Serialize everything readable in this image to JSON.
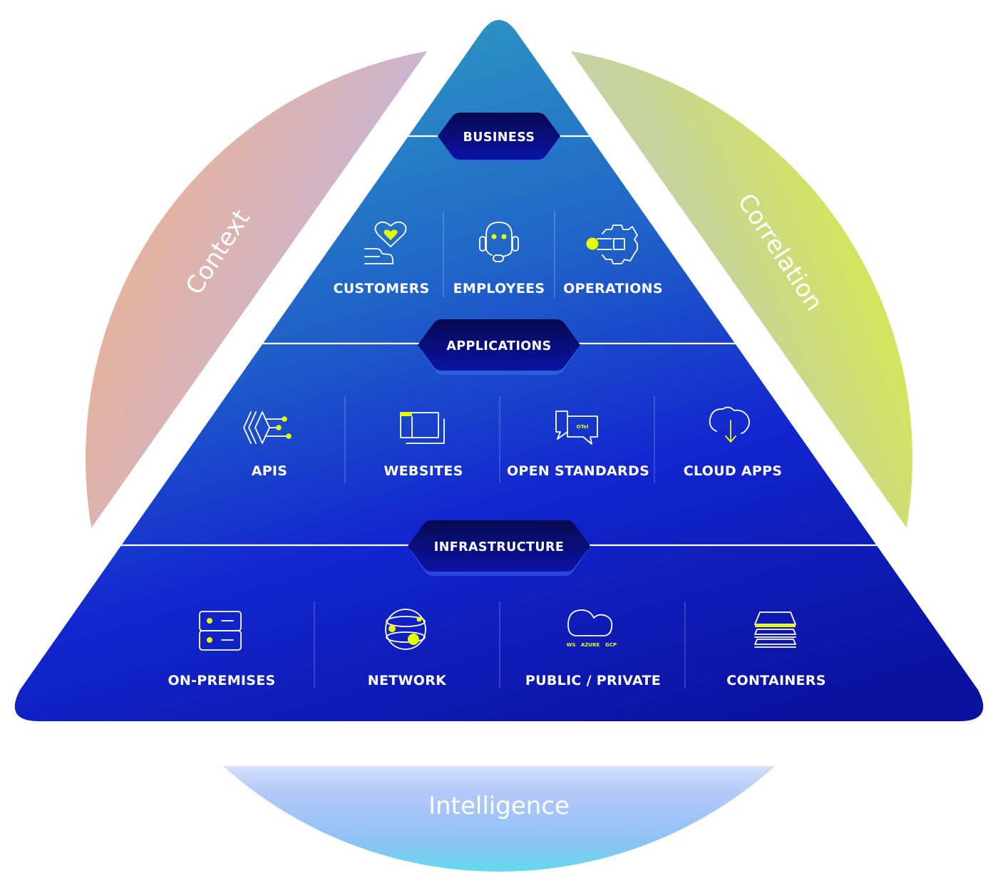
{
  "diagram": {
    "outer_labels": {
      "left": "Context",
      "right": "Correlation",
      "bottom": "Intelligence"
    },
    "colors": {
      "context_gradient": [
        "#ffae6b",
        "#c7b8de",
        "#ffffff"
      ],
      "correlation_gradient": [
        "#e6ff00",
        "#c3cfcf",
        "#ffffff"
      ],
      "intelligence_gradient": [
        "#ffffff",
        "#a9c6f7",
        "#3ff0e6"
      ],
      "pyramid_top": "#2d96c0",
      "pyramid_bottom": "#0e16b8",
      "badge_fill": "#080d6a",
      "accent": "#e6ff00"
    },
    "tiers": [
      {
        "badge": "BUSINESS",
        "items": [
          {
            "label": "CUSTOMERS",
            "icon": "hand-heart-icon"
          },
          {
            "label": "EMPLOYEES",
            "icon": "headset-agent-icon"
          },
          {
            "label": "OPERATIONS",
            "icon": "gear-process-icon"
          }
        ]
      },
      {
        "badge": "APPLICATIONS",
        "items": [
          {
            "label": "APIS",
            "icon": "api-nodes-icon"
          },
          {
            "label": "WEBSITES",
            "icon": "browser-windows-icon"
          },
          {
            "label": "OPEN STANDARDS",
            "icon": "chat-bubbles-icon",
            "icon_text": "OTel"
          },
          {
            "label": "CLOUD APPS",
            "icon": "cloud-download-icon"
          }
        ]
      },
      {
        "badge": "INFRASTRUCTURE",
        "items": [
          {
            "label": "ON-PREMISES",
            "icon": "server-rack-icon"
          },
          {
            "label": "NETWORK",
            "icon": "globe-network-icon"
          },
          {
            "label": "PUBLIC / PRIVATE",
            "icon": "cloud-providers-icon",
            "icon_text": [
              "WS",
              "AZURE",
              "GCP"
            ]
          },
          {
            "label": "CONTAINERS",
            "icon": "stacked-layers-icon"
          }
        ]
      }
    ]
  }
}
